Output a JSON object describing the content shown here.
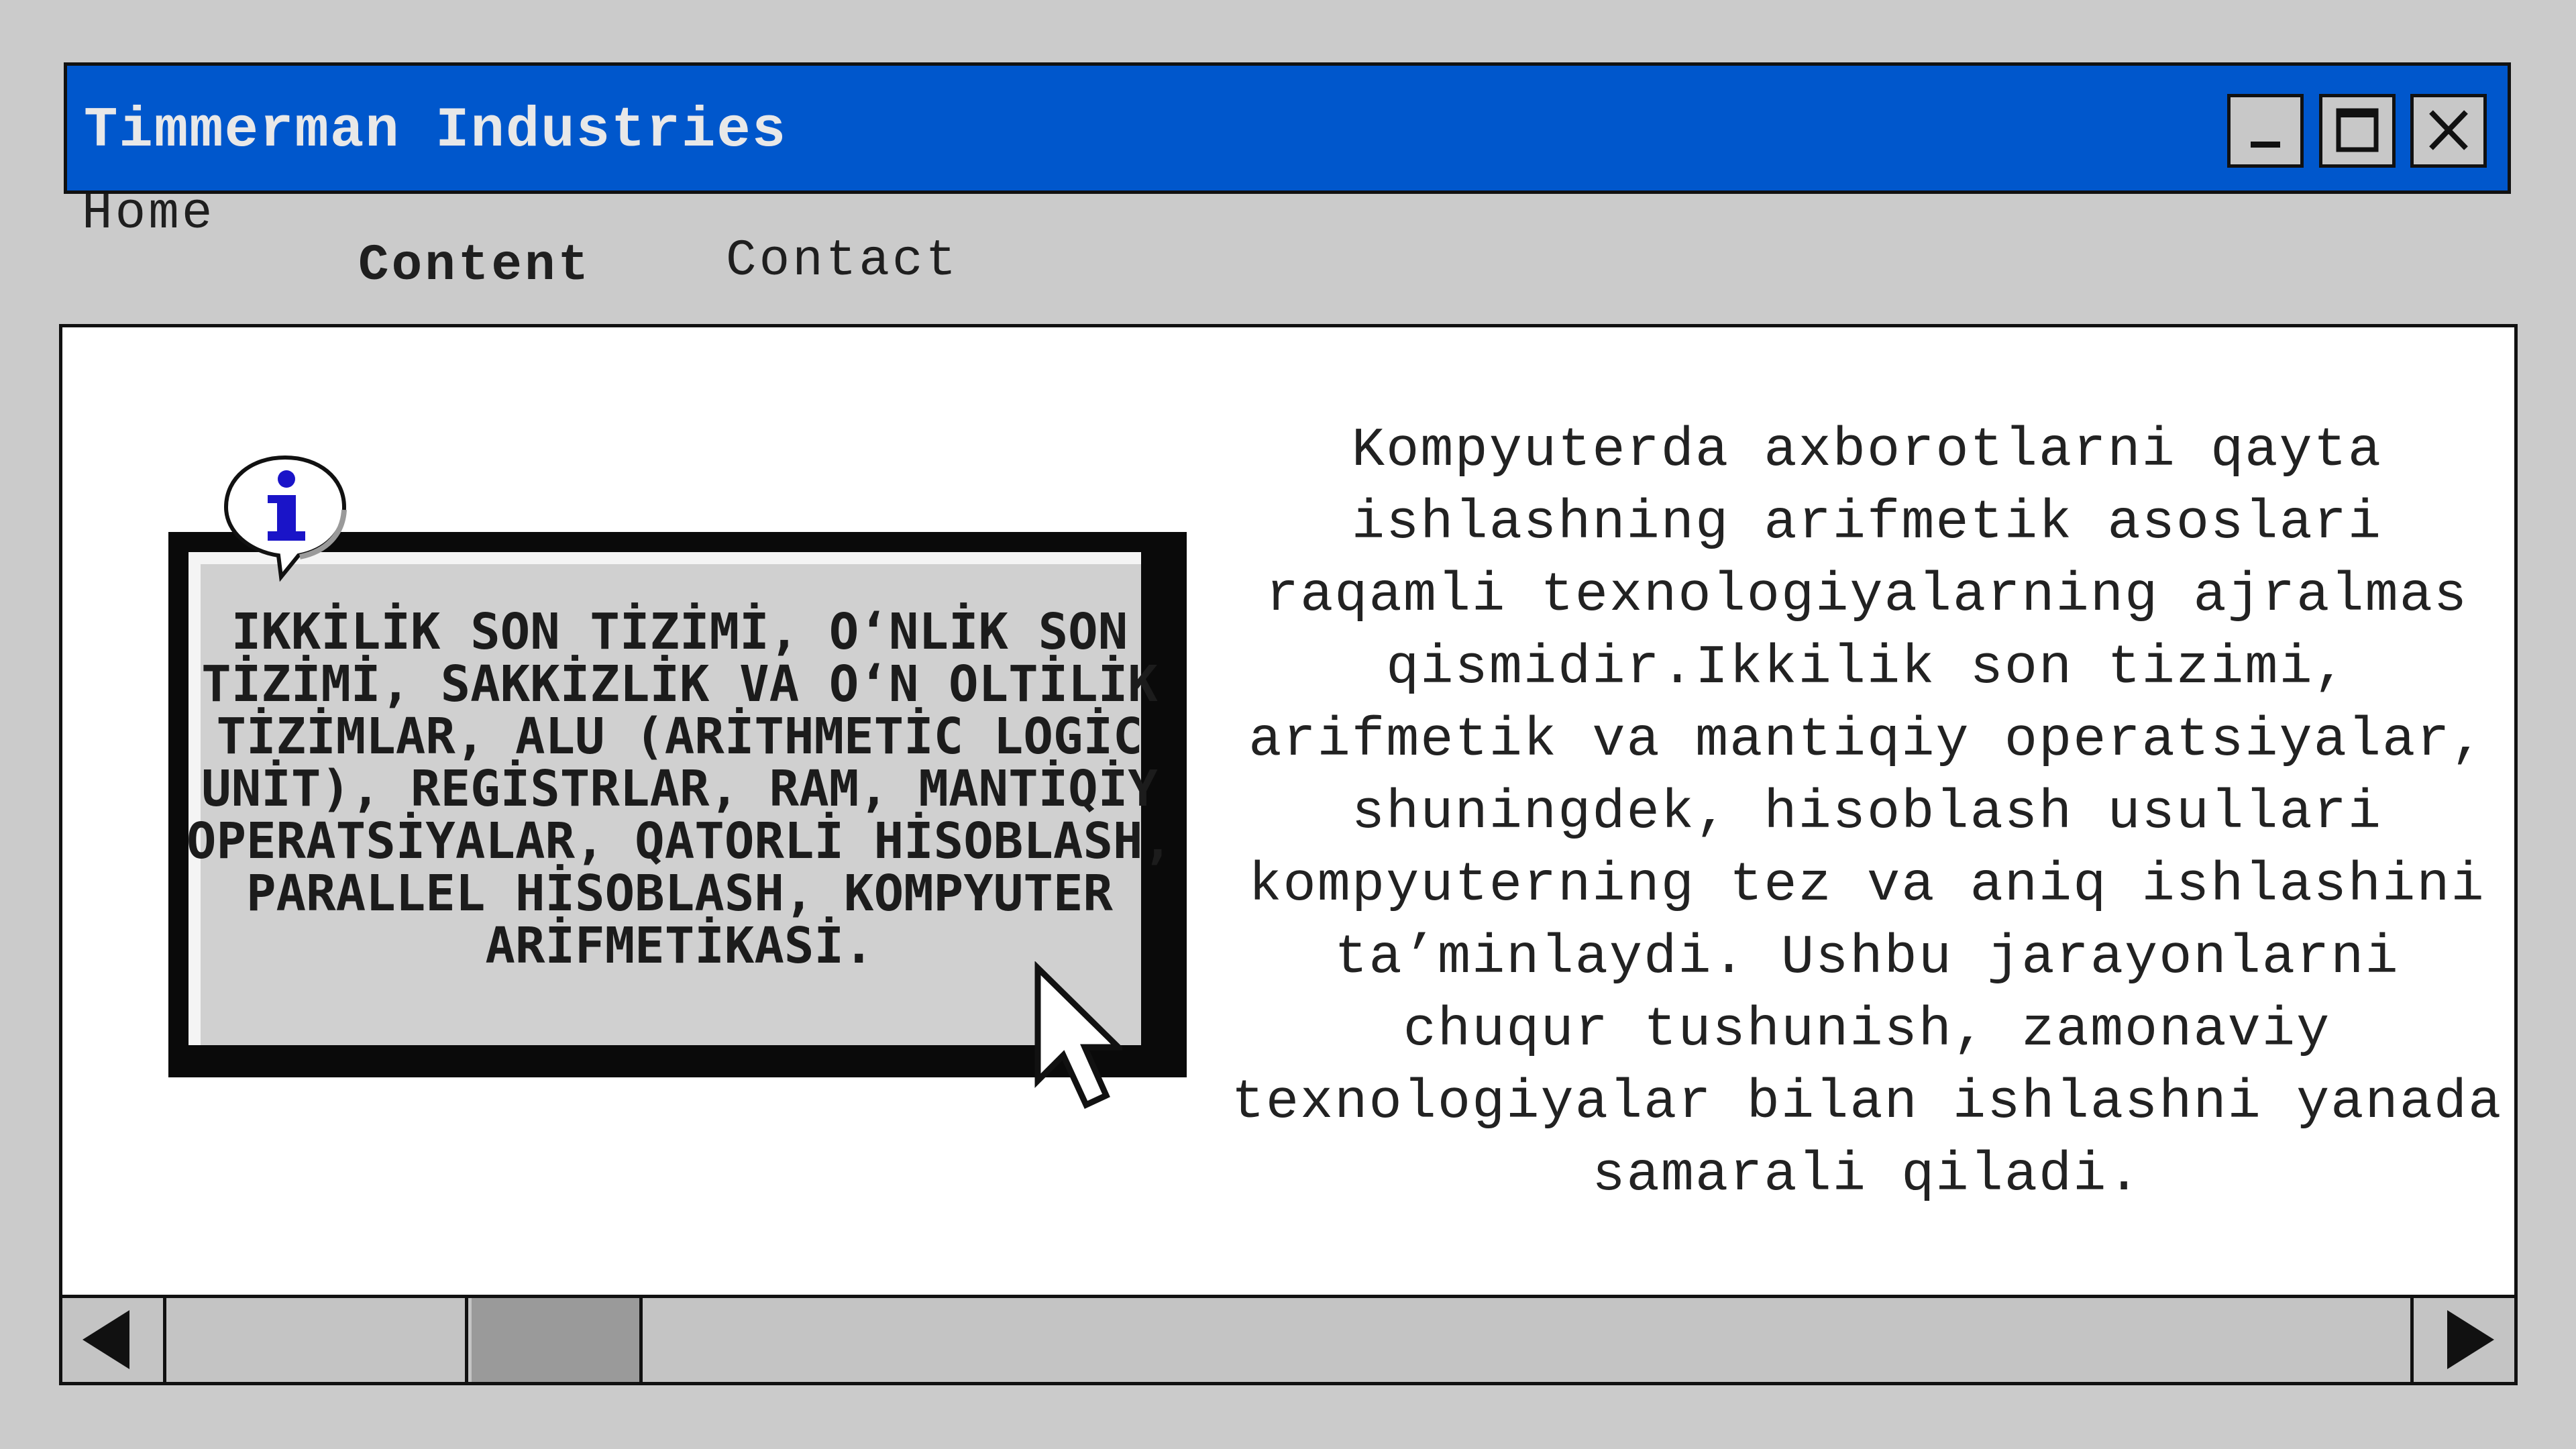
{
  "window": {
    "title": "Timmerman Industries",
    "title_bar_color": "#0057cc",
    "controls": [
      "minimize-icon",
      "maximize-icon",
      "close-icon"
    ]
  },
  "nav": {
    "items": [
      {
        "label": "Home",
        "active": false
      },
      {
        "label": "Content",
        "active": true
      },
      {
        "label": "Contact",
        "active": false
      }
    ]
  },
  "info_box": {
    "icon": "info-icon",
    "text": "IKKİLİK SON TİZİMİ, O‘NLİK SON TİZİMİ, SAKKİZLİK VA O‘N OLTİLİK TİZİMLAR, ALU (ARİTHMETİC LOGİC UNİT), REGİSTRLAR, RAM, MANTİQİY OPERATSİYALAR, QATORLİ HİSOBLASH, PARALLEL HİSOBLASH, KOMPYUTER ARİFMETİKASİ."
  },
  "main": {
    "paragraph": "Kompyuterda axborotlarni qayta ishlashning arifmetik asoslari raqamli texnologiyalarning ajralmas qismidir.Ikkilik son tizimi, arifmetik va mantiqiy operatsiyalar, shuningdek, hisoblash usullari kompyuterning tez va aniq ishlashini ta’minlaydi. Ushbu jarayonlarni chuqur tushunish, zamonaviy texnologiyalar bilan ishlashni yanada samarali qiladi."
  },
  "scrollbar": {
    "left_icon": "arrow-left-icon",
    "right_icon": "arrow-right-icon"
  }
}
